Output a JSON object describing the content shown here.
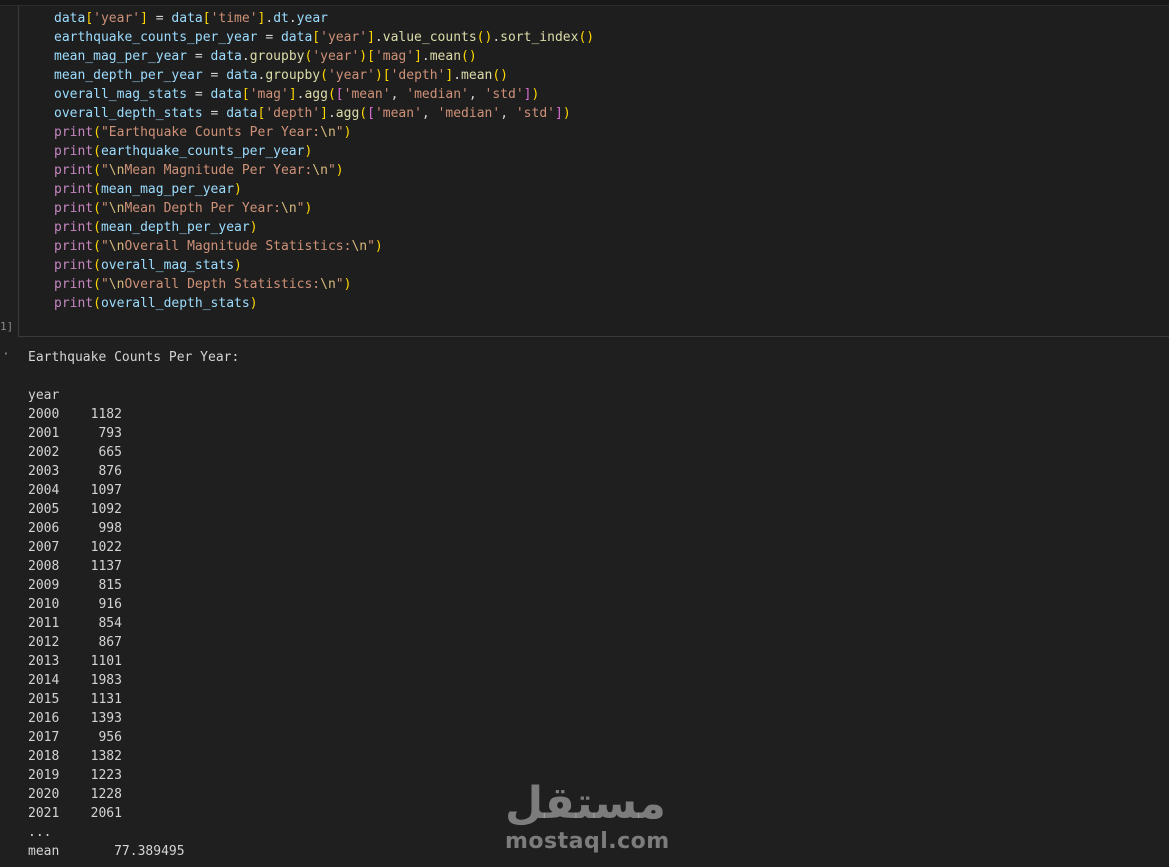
{
  "cell": {
    "exec_count": "1]",
    "code_lines": [
      [
        [
          "tok-var",
          "data"
        ],
        [
          "tok-br1",
          "["
        ],
        [
          "tok-str",
          "'year'"
        ],
        [
          "tok-br1",
          "]"
        ],
        [
          "tok-op",
          " = "
        ],
        [
          "tok-var",
          "data"
        ],
        [
          "tok-br1",
          "["
        ],
        [
          "tok-str",
          "'time'"
        ],
        [
          "tok-br1",
          "]"
        ],
        [
          "tok-op",
          "."
        ],
        [
          "tok-var",
          "dt"
        ],
        [
          "tok-op",
          "."
        ],
        [
          "tok-var",
          "year"
        ]
      ],
      [
        [
          "tok-var",
          "earthquake_counts_per_year"
        ],
        [
          "tok-op",
          " = "
        ],
        [
          "tok-var",
          "data"
        ],
        [
          "tok-br1",
          "["
        ],
        [
          "tok-str",
          "'year'"
        ],
        [
          "tok-br1",
          "]"
        ],
        [
          "tok-op",
          "."
        ],
        [
          "tok-fn",
          "value_counts"
        ],
        [
          "tok-br1",
          "()"
        ],
        [
          "tok-op",
          "."
        ],
        [
          "tok-fn",
          "sort_index"
        ],
        [
          "tok-br1",
          "()"
        ]
      ],
      [
        [
          "tok-var",
          "mean_mag_per_year"
        ],
        [
          "tok-op",
          " = "
        ],
        [
          "tok-var",
          "data"
        ],
        [
          "tok-op",
          "."
        ],
        [
          "tok-fn",
          "groupby"
        ],
        [
          "tok-br1",
          "("
        ],
        [
          "tok-str",
          "'year'"
        ],
        [
          "tok-br1",
          ")"
        ],
        [
          "tok-br1",
          "["
        ],
        [
          "tok-str",
          "'mag'"
        ],
        [
          "tok-br1",
          "]"
        ],
        [
          "tok-op",
          "."
        ],
        [
          "tok-fn",
          "mean"
        ],
        [
          "tok-br1",
          "()"
        ]
      ],
      [
        [
          "tok-var",
          "mean_depth_per_year"
        ],
        [
          "tok-op",
          " = "
        ],
        [
          "tok-var",
          "data"
        ],
        [
          "tok-op",
          "."
        ],
        [
          "tok-fn",
          "groupby"
        ],
        [
          "tok-br1",
          "("
        ],
        [
          "tok-str",
          "'year'"
        ],
        [
          "tok-br1",
          ")"
        ],
        [
          "tok-br1",
          "["
        ],
        [
          "tok-str",
          "'depth'"
        ],
        [
          "tok-br1",
          "]"
        ],
        [
          "tok-op",
          "."
        ],
        [
          "tok-fn",
          "mean"
        ],
        [
          "tok-br1",
          "()"
        ]
      ],
      [
        [
          "tok-var",
          "overall_mag_stats"
        ],
        [
          "tok-op",
          " = "
        ],
        [
          "tok-var",
          "data"
        ],
        [
          "tok-br1",
          "["
        ],
        [
          "tok-str",
          "'mag'"
        ],
        [
          "tok-br1",
          "]"
        ],
        [
          "tok-op",
          "."
        ],
        [
          "tok-fn",
          "agg"
        ],
        [
          "tok-br1",
          "("
        ],
        [
          "tok-br2",
          "["
        ],
        [
          "tok-str",
          "'mean'"
        ],
        [
          "tok-op",
          ", "
        ],
        [
          "tok-str",
          "'median'"
        ],
        [
          "tok-op",
          ", "
        ],
        [
          "tok-str",
          "'std'"
        ],
        [
          "tok-br2",
          "]"
        ],
        [
          "tok-br1",
          ")"
        ]
      ],
      [
        [
          "tok-var",
          "overall_depth_stats"
        ],
        [
          "tok-op",
          " = "
        ],
        [
          "tok-var",
          "data"
        ],
        [
          "tok-br1",
          "["
        ],
        [
          "tok-str",
          "'depth'"
        ],
        [
          "tok-br1",
          "]"
        ],
        [
          "tok-op",
          "."
        ],
        [
          "tok-fn",
          "agg"
        ],
        [
          "tok-br1",
          "("
        ],
        [
          "tok-br2",
          "["
        ],
        [
          "tok-str",
          "'mean'"
        ],
        [
          "tok-op",
          ", "
        ],
        [
          "tok-str",
          "'median'"
        ],
        [
          "tok-op",
          ", "
        ],
        [
          "tok-str",
          "'std'"
        ],
        [
          "tok-br2",
          "]"
        ],
        [
          "tok-br1",
          ")"
        ]
      ],
      [
        [
          "tok-kw",
          "print"
        ],
        [
          "tok-br1",
          "("
        ],
        [
          "tok-str",
          "\"Earthquake Counts Per Year:"
        ],
        [
          "tok-esc",
          "\\n"
        ],
        [
          "tok-str",
          "\""
        ],
        [
          "tok-br1",
          ")"
        ]
      ],
      [
        [
          "tok-kw",
          "print"
        ],
        [
          "tok-br1",
          "("
        ],
        [
          "tok-var",
          "earthquake_counts_per_year"
        ],
        [
          "tok-br1",
          ")"
        ]
      ],
      [
        [
          "tok-kw",
          "print"
        ],
        [
          "tok-br1",
          "("
        ],
        [
          "tok-str",
          "\""
        ],
        [
          "tok-esc",
          "\\n"
        ],
        [
          "tok-str",
          "Mean Magnitude Per Year:"
        ],
        [
          "tok-esc",
          "\\n"
        ],
        [
          "tok-str",
          "\""
        ],
        [
          "tok-br1",
          ")"
        ]
      ],
      [
        [
          "tok-kw",
          "print"
        ],
        [
          "tok-br1",
          "("
        ],
        [
          "tok-var",
          "mean_mag_per_year"
        ],
        [
          "tok-br1",
          ")"
        ]
      ],
      [
        [
          "tok-kw",
          "print"
        ],
        [
          "tok-br1",
          "("
        ],
        [
          "tok-str",
          "\""
        ],
        [
          "tok-esc",
          "\\n"
        ],
        [
          "tok-str",
          "Mean Depth Per Year:"
        ],
        [
          "tok-esc",
          "\\n"
        ],
        [
          "tok-str",
          "\""
        ],
        [
          "tok-br1",
          ")"
        ]
      ],
      [
        [
          "tok-kw",
          "print"
        ],
        [
          "tok-br1",
          "("
        ],
        [
          "tok-var",
          "mean_depth_per_year"
        ],
        [
          "tok-br1",
          ")"
        ]
      ],
      [
        [
          "tok-kw",
          "print"
        ],
        [
          "tok-br1",
          "("
        ],
        [
          "tok-str",
          "\""
        ],
        [
          "tok-esc",
          "\\n"
        ],
        [
          "tok-str",
          "Overall Magnitude Statistics:"
        ],
        [
          "tok-esc",
          "\\n"
        ],
        [
          "tok-str",
          "\""
        ],
        [
          "tok-br1",
          ")"
        ]
      ],
      [
        [
          "tok-kw",
          "print"
        ],
        [
          "tok-br1",
          "("
        ],
        [
          "tok-var",
          "overall_mag_stats"
        ],
        [
          "tok-br1",
          ")"
        ]
      ],
      [
        [
          "tok-kw",
          "print"
        ],
        [
          "tok-br1",
          "("
        ],
        [
          "tok-str",
          "\""
        ],
        [
          "tok-esc",
          "\\n"
        ],
        [
          "tok-str",
          "Overall Depth Statistics:"
        ],
        [
          "tok-esc",
          "\\n"
        ],
        [
          "tok-str",
          "\""
        ],
        [
          "tok-br1",
          ")"
        ]
      ],
      [
        [
          "tok-kw",
          "print"
        ],
        [
          "tok-br1",
          "("
        ],
        [
          "tok-var",
          "overall_depth_stats"
        ],
        [
          "tok-br1",
          ")"
        ]
      ]
    ]
  },
  "output": {
    "marker": "·",
    "title": "Earthquake Counts Per Year:",
    "index_name": "year",
    "rows": [
      {
        "year": "2000",
        "count": "1182"
      },
      {
        "year": "2001",
        "count": "793"
      },
      {
        "year": "2002",
        "count": "665"
      },
      {
        "year": "2003",
        "count": "876"
      },
      {
        "year": "2004",
        "count": "1097"
      },
      {
        "year": "2005",
        "count": "1092"
      },
      {
        "year": "2006",
        "count": "998"
      },
      {
        "year": "2007",
        "count": "1022"
      },
      {
        "year": "2008",
        "count": "1137"
      },
      {
        "year": "2009",
        "count": "815"
      },
      {
        "year": "2010",
        "count": "916"
      },
      {
        "year": "2011",
        "count": "854"
      },
      {
        "year": "2012",
        "count": "867"
      },
      {
        "year": "2013",
        "count": "1101"
      },
      {
        "year": "2014",
        "count": "1983"
      },
      {
        "year": "2015",
        "count": "1131"
      },
      {
        "year": "2016",
        "count": "1393"
      },
      {
        "year": "2017",
        "count": "956"
      },
      {
        "year": "2018",
        "count": "1382"
      },
      {
        "year": "2019",
        "count": "1223"
      },
      {
        "year": "2020",
        "count": "1228"
      },
      {
        "year": "2021",
        "count": "2061"
      }
    ],
    "ellipsis": "...",
    "stats": [
      {
        "label": "mean",
        "value": "77.389495"
      }
    ]
  },
  "watermark": {
    "arabic": "مستقل",
    "latin": "mostaql.com"
  }
}
